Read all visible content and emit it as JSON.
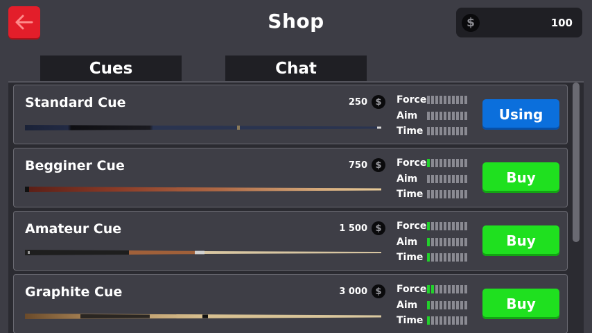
{
  "header": {
    "title": "Shop",
    "coins": "100",
    "coin_symbol": "$"
  },
  "tabs": [
    {
      "label": "Cues",
      "active": true
    },
    {
      "label": "Chat",
      "active": false
    }
  ],
  "stat_labels": {
    "force": "Force",
    "aim": "Aim",
    "time": "Time"
  },
  "items": [
    {
      "name": "Standard Cue",
      "price": "250",
      "force": 0,
      "aim": 0,
      "time": 0,
      "action": "Using",
      "action_color": "#0b6fdc"
    },
    {
      "name": "Begginer Cue",
      "price": "750",
      "force": 1,
      "aim": 0,
      "time": 0,
      "action": "Buy",
      "action_color": "#1fe01f"
    },
    {
      "name": "Amateur Cue",
      "price": "1 500",
      "force": 1,
      "aim": 1,
      "time": 1,
      "action": "Buy",
      "action_color": "#1fe01f"
    },
    {
      "name": "Graphite Cue",
      "price": "3 000",
      "force": 2,
      "aim": 1,
      "time": 1,
      "action": "Buy",
      "action_color": "#1fe01f"
    }
  ],
  "stat_max": 10,
  "colors": {
    "accent_red": "#e31e2a",
    "bar_on": "#22d12c",
    "bar_off": "#8a8a92"
  }
}
